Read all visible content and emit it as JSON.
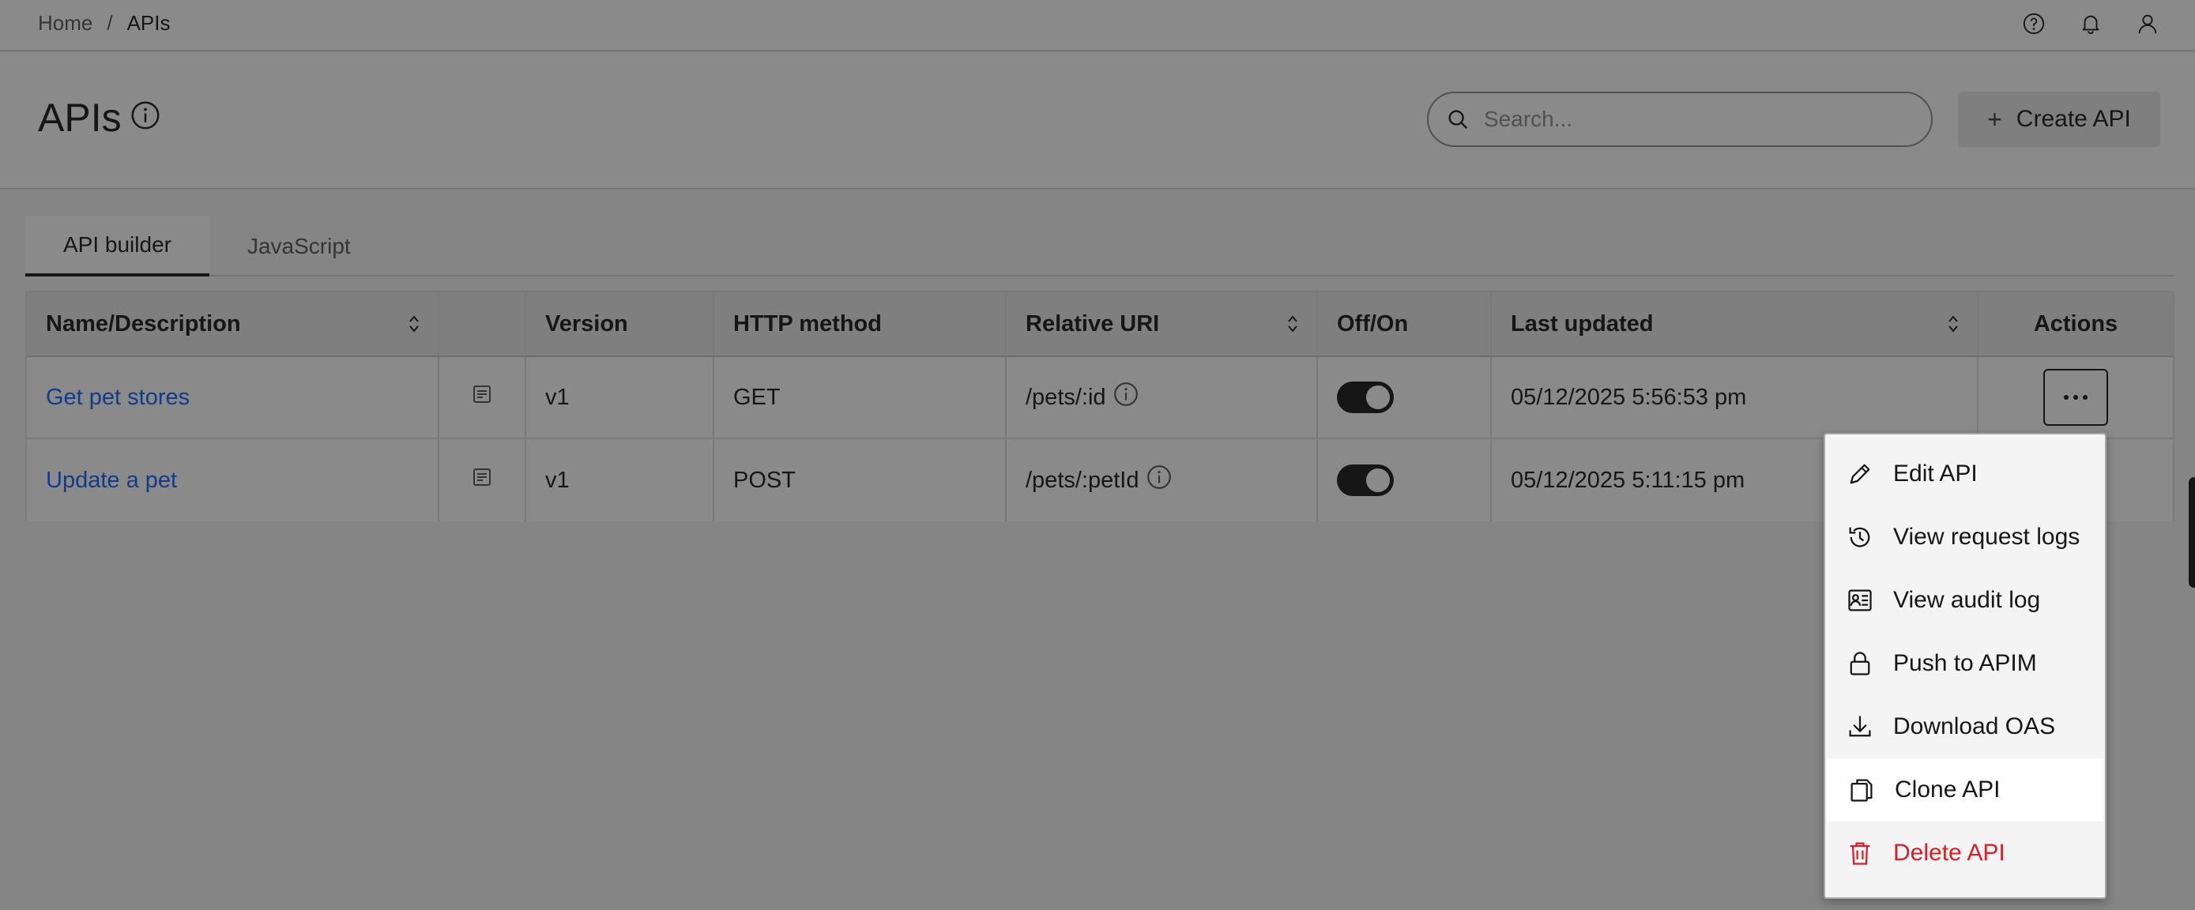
{
  "breadcrumb": {
    "home": "Home",
    "separator": "/",
    "current": "APIs"
  },
  "topbar_icons": [
    "help-icon",
    "notification-icon",
    "user-icon"
  ],
  "header": {
    "title": "APIs",
    "search_placeholder": "Search...",
    "create_label": "Create API",
    "create_icon": "+"
  },
  "tabs": [
    {
      "label": "API builder",
      "active": true
    },
    {
      "label": "JavaScript",
      "active": false
    }
  ],
  "table": {
    "columns": [
      "Name/Description",
      "",
      "Version",
      "HTTP method",
      "Relative URI",
      "Off/On",
      "Last updated",
      "Actions"
    ],
    "rows": [
      {
        "name": "Get pet stores",
        "version": "v1",
        "method": "GET",
        "uri": "/pets/:id",
        "enabled": true,
        "updated": "05/12/2025 5:56:53 pm"
      },
      {
        "name": "Update a pet",
        "version": "v1",
        "method": "POST",
        "uri": "/pets/:petId",
        "enabled": true,
        "updated": "05/12/2025 5:11:15 pm"
      }
    ]
  },
  "actions_menu": {
    "items": [
      {
        "label": "Edit API",
        "icon": "edit-icon"
      },
      {
        "label": "View request logs",
        "icon": "history-icon"
      },
      {
        "label": "View audit log",
        "icon": "audit-log-icon"
      },
      {
        "label": "Push to APIM",
        "icon": "lock-icon"
      },
      {
        "label": "Download OAS",
        "icon": "download-icon"
      },
      {
        "label": "Clone API",
        "icon": "copy-icon",
        "highlighted": true
      },
      {
        "label": "Delete API",
        "icon": "trash-icon",
        "danger": true
      }
    ]
  },
  "colors": {
    "link": "#0f62fe",
    "danger": "#da1e28",
    "toggle_on": "#161616"
  }
}
